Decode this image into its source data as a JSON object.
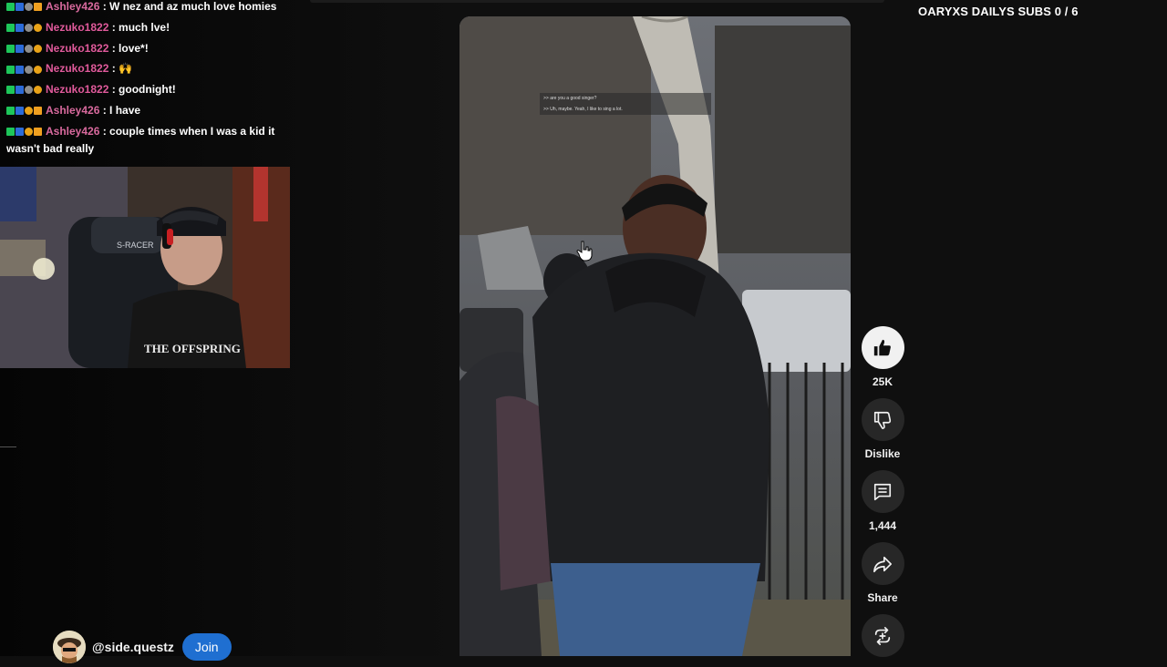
{
  "chat": {
    "messages": [
      {
        "user": "Ashley426",
        "text": "W nez and az much love homies",
        "wrap": true,
        "badges": [
          "green",
          "blue",
          "gray",
          "gift"
        ]
      },
      {
        "user": "Nezuko1822",
        "text": "much lve!",
        "wrap": false,
        "badges": [
          "green",
          "blue",
          "gray",
          "yellow"
        ]
      },
      {
        "user": "Nezuko1822",
        "text": "love*!",
        "wrap": false,
        "badges": [
          "green",
          "blue",
          "gray",
          "yellow"
        ]
      },
      {
        "user": "Nezuko1822",
        "text": "🙌",
        "wrap": false,
        "badges": [
          "green",
          "blue",
          "gray",
          "yellow"
        ]
      },
      {
        "user": "Nezuko1822",
        "text": "goodnight!",
        "wrap": false,
        "badges": [
          "green",
          "blue",
          "gray",
          "yellow"
        ]
      },
      {
        "user": "Ashley426",
        "text": "I have",
        "wrap": false,
        "badges": [
          "green",
          "blue",
          "yellow",
          "gift"
        ]
      },
      {
        "user": "Ashley426",
        "text": "couple times when I was a kid it wasn't bad really",
        "wrap": true,
        "badges": [
          "green",
          "blue",
          "yellow",
          "gift"
        ]
      }
    ]
  },
  "overlay": {
    "subs_counter": "OARYXS DAILYS SUBS 0 / 6",
    "shirt_text": "THE OFFSPRING",
    "chair_text": "S-RACER"
  },
  "video": {
    "captions": [
      ">> are you a good singer?",
      ">> Uh, maybe. Yeah, I like to sing a lot."
    ]
  },
  "actions": {
    "like": {
      "icon": "thumbs-up-icon",
      "label": "25K"
    },
    "dislike": {
      "icon": "thumbs-down-icon",
      "label": "Dislike"
    },
    "comments": {
      "icon": "comment-icon",
      "label": "1,444"
    },
    "share": {
      "icon": "share-icon",
      "label": "Share"
    },
    "remix": {
      "icon": "remix-icon",
      "label": ""
    }
  },
  "channel": {
    "handle": "@side.questz",
    "join_label": "Join"
  },
  "colors": {
    "username_pink": "#e05a9b",
    "join_blue": "#1f6fd1",
    "background": "#0f0f0f"
  }
}
